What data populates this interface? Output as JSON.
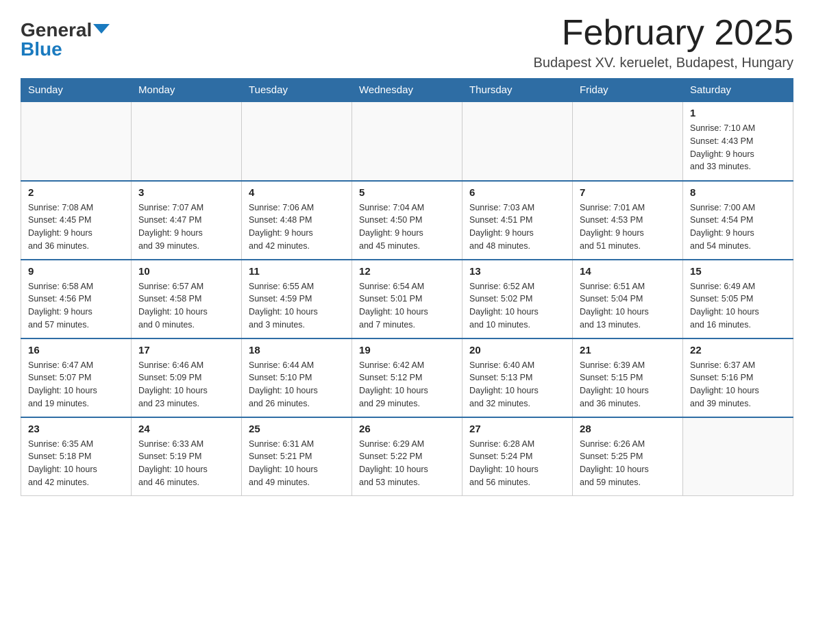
{
  "header": {
    "logo": {
      "general": "General",
      "blue": "Blue",
      "triangle": "▲"
    },
    "title": "February 2025",
    "location": "Budapest XV. keruelet, Budapest, Hungary"
  },
  "weekdays": [
    "Sunday",
    "Monday",
    "Tuesday",
    "Wednesday",
    "Thursday",
    "Friday",
    "Saturday"
  ],
  "weeks": [
    [
      {
        "day": "",
        "info": ""
      },
      {
        "day": "",
        "info": ""
      },
      {
        "day": "",
        "info": ""
      },
      {
        "day": "",
        "info": ""
      },
      {
        "day": "",
        "info": ""
      },
      {
        "day": "",
        "info": ""
      },
      {
        "day": "1",
        "info": "Sunrise: 7:10 AM\nSunset: 4:43 PM\nDaylight: 9 hours\nand 33 minutes."
      }
    ],
    [
      {
        "day": "2",
        "info": "Sunrise: 7:08 AM\nSunset: 4:45 PM\nDaylight: 9 hours\nand 36 minutes."
      },
      {
        "day": "3",
        "info": "Sunrise: 7:07 AM\nSunset: 4:47 PM\nDaylight: 9 hours\nand 39 minutes."
      },
      {
        "day": "4",
        "info": "Sunrise: 7:06 AM\nSunset: 4:48 PM\nDaylight: 9 hours\nand 42 minutes."
      },
      {
        "day": "5",
        "info": "Sunrise: 7:04 AM\nSunset: 4:50 PM\nDaylight: 9 hours\nand 45 minutes."
      },
      {
        "day": "6",
        "info": "Sunrise: 7:03 AM\nSunset: 4:51 PM\nDaylight: 9 hours\nand 48 minutes."
      },
      {
        "day": "7",
        "info": "Sunrise: 7:01 AM\nSunset: 4:53 PM\nDaylight: 9 hours\nand 51 minutes."
      },
      {
        "day": "8",
        "info": "Sunrise: 7:00 AM\nSunset: 4:54 PM\nDaylight: 9 hours\nand 54 minutes."
      }
    ],
    [
      {
        "day": "9",
        "info": "Sunrise: 6:58 AM\nSunset: 4:56 PM\nDaylight: 9 hours\nand 57 minutes."
      },
      {
        "day": "10",
        "info": "Sunrise: 6:57 AM\nSunset: 4:58 PM\nDaylight: 10 hours\nand 0 minutes."
      },
      {
        "day": "11",
        "info": "Sunrise: 6:55 AM\nSunset: 4:59 PM\nDaylight: 10 hours\nand 3 minutes."
      },
      {
        "day": "12",
        "info": "Sunrise: 6:54 AM\nSunset: 5:01 PM\nDaylight: 10 hours\nand 7 minutes."
      },
      {
        "day": "13",
        "info": "Sunrise: 6:52 AM\nSunset: 5:02 PM\nDaylight: 10 hours\nand 10 minutes."
      },
      {
        "day": "14",
        "info": "Sunrise: 6:51 AM\nSunset: 5:04 PM\nDaylight: 10 hours\nand 13 minutes."
      },
      {
        "day": "15",
        "info": "Sunrise: 6:49 AM\nSunset: 5:05 PM\nDaylight: 10 hours\nand 16 minutes."
      }
    ],
    [
      {
        "day": "16",
        "info": "Sunrise: 6:47 AM\nSunset: 5:07 PM\nDaylight: 10 hours\nand 19 minutes."
      },
      {
        "day": "17",
        "info": "Sunrise: 6:46 AM\nSunset: 5:09 PM\nDaylight: 10 hours\nand 23 minutes."
      },
      {
        "day": "18",
        "info": "Sunrise: 6:44 AM\nSunset: 5:10 PM\nDaylight: 10 hours\nand 26 minutes."
      },
      {
        "day": "19",
        "info": "Sunrise: 6:42 AM\nSunset: 5:12 PM\nDaylight: 10 hours\nand 29 minutes."
      },
      {
        "day": "20",
        "info": "Sunrise: 6:40 AM\nSunset: 5:13 PM\nDaylight: 10 hours\nand 32 minutes."
      },
      {
        "day": "21",
        "info": "Sunrise: 6:39 AM\nSunset: 5:15 PM\nDaylight: 10 hours\nand 36 minutes."
      },
      {
        "day": "22",
        "info": "Sunrise: 6:37 AM\nSunset: 5:16 PM\nDaylight: 10 hours\nand 39 minutes."
      }
    ],
    [
      {
        "day": "23",
        "info": "Sunrise: 6:35 AM\nSunset: 5:18 PM\nDaylight: 10 hours\nand 42 minutes."
      },
      {
        "day": "24",
        "info": "Sunrise: 6:33 AM\nSunset: 5:19 PM\nDaylight: 10 hours\nand 46 minutes."
      },
      {
        "day": "25",
        "info": "Sunrise: 6:31 AM\nSunset: 5:21 PM\nDaylight: 10 hours\nand 49 minutes."
      },
      {
        "day": "26",
        "info": "Sunrise: 6:29 AM\nSunset: 5:22 PM\nDaylight: 10 hours\nand 53 minutes."
      },
      {
        "day": "27",
        "info": "Sunrise: 6:28 AM\nSunset: 5:24 PM\nDaylight: 10 hours\nand 56 minutes."
      },
      {
        "day": "28",
        "info": "Sunrise: 6:26 AM\nSunset: 5:25 PM\nDaylight: 10 hours\nand 59 minutes."
      },
      {
        "day": "",
        "info": ""
      }
    ]
  ]
}
